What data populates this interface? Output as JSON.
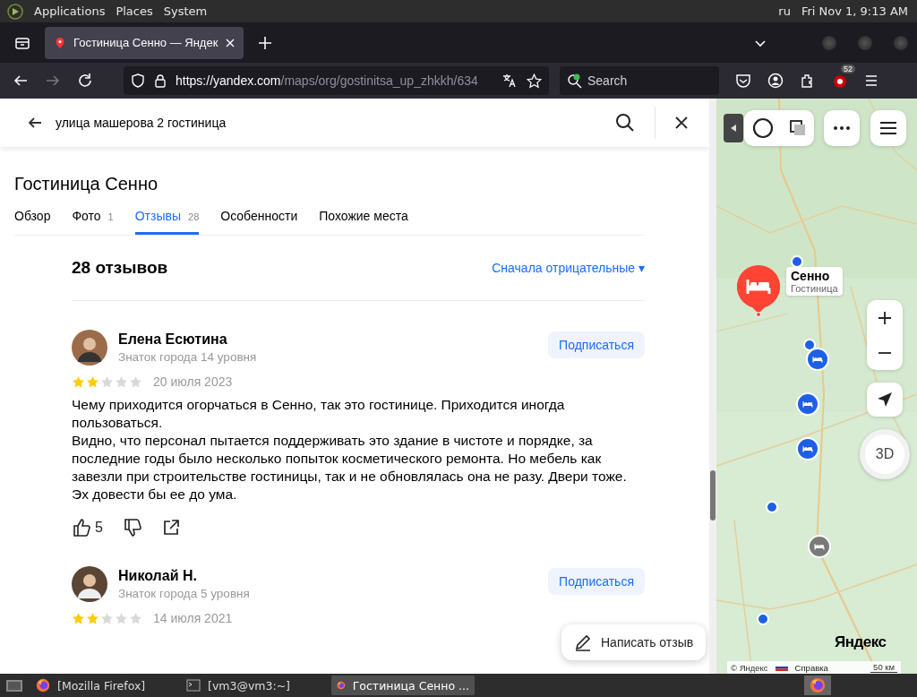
{
  "top_panel": {
    "menus": [
      "Applications",
      "Places",
      "System"
    ],
    "keyboard_layout": "ru",
    "clock": "Fri Nov 1, 9:13 AM"
  },
  "browser": {
    "tabs": [
      {
        "title": "Гостиница Сенно — Яндек",
        "selected": true
      }
    ],
    "url": {
      "host": "https://yandex.com",
      "path": "/maps/org/gostinitsa_up_zhkkh/634"
    },
    "search": {
      "placeholder": "Search"
    },
    "extension_badge": "52"
  },
  "search_bar": {
    "value": "улица машерова 2 гостиница"
  },
  "place": {
    "title": "Гостиница Сенно",
    "tabs": [
      {
        "label": "Обзор",
        "selected": false
      },
      {
        "label": "Фото",
        "count": "1",
        "selected": false
      },
      {
        "label": "Отзывы",
        "count": "28",
        "selected": true
      },
      {
        "label": "Особенности",
        "selected": false
      },
      {
        "label": "Похожие места",
        "selected": false
      }
    ]
  },
  "reviews": {
    "heading": "28 отзывов",
    "sort": "Сначала отрицательные ▾",
    "items": [
      {
        "author": "Елена Есютина",
        "level": "Знаток города 14 уровня",
        "subscribe": "Подписаться",
        "stars": 2,
        "date": "20 июля 2023",
        "paragraphs": [
          "Чему приходится огорчаться в Сенно, так это гостинице. Приходится иногда пользоваться.",
          "Видно, что персонал пытается поддерживать это здание в чистоте и порядке, за последние годы было несколько попыток косметического ремонта. Но мебель как завезли при строительстве гостиницы, так и не обновлялась она не разу. Двери тоже.",
          "Эх довести бы ее до ума."
        ],
        "likes": "5"
      },
      {
        "author": "Николай Н.",
        "level": "Знаток города 5 уровня",
        "subscribe": "Подписаться",
        "stars": 2,
        "date": "14 июля 2021"
      }
    ],
    "write_button": "Написать отзыв"
  },
  "map": {
    "place_label": {
      "name": "Сенно",
      "type": "Гостиница"
    },
    "compass": "3D",
    "logo": "Яндекс",
    "attribution": "© Яндекс",
    "help": "Справка",
    "scale": "50 км"
  },
  "taskbar": [
    {
      "title": "[Mozilla Firefox]",
      "kind": "firefox",
      "selected": false
    },
    {
      "title": "[vm3@vm3:~]",
      "kind": "terminal",
      "selected": false
    },
    {
      "title": "Гостиница Сенно ...",
      "kind": "firefox",
      "selected": true
    }
  ]
}
